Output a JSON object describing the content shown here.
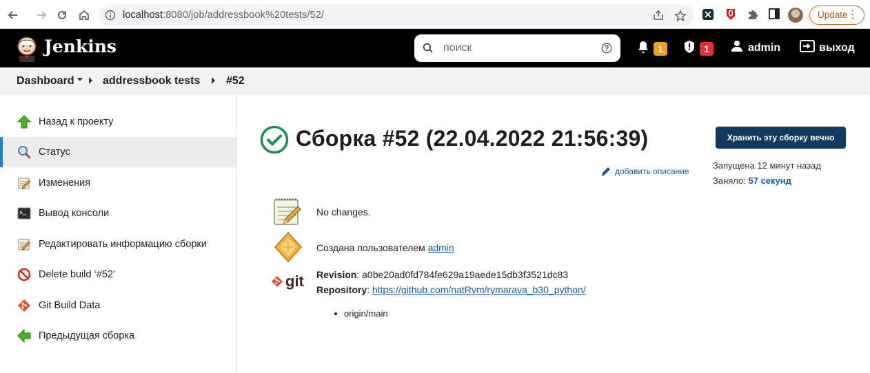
{
  "browser": {
    "url_host": "localhost",
    "url_path": ":8080/job/addressbook%20tests/52/",
    "update_label": "Update"
  },
  "header": {
    "brand": "Jenkins",
    "search_placeholder": "поиск",
    "notifications_count": "1",
    "security_count": "1",
    "user": "admin",
    "logout": "выход"
  },
  "breadcrumbs": {
    "dashboard": "Dashboard",
    "job": "addressbook tests",
    "build": "#52"
  },
  "sidebar": {
    "items": [
      {
        "label": "Назад к проекту",
        "icon": "up-arrow-icon"
      },
      {
        "label": "Статус",
        "icon": "magnifier-icon"
      },
      {
        "label": "Изменения",
        "icon": "notepad-icon"
      },
      {
        "label": "Вывод консоли",
        "icon": "terminal-icon"
      },
      {
        "label": "Редактировать информацию сборки",
        "icon": "notepad-icon"
      },
      {
        "label": "Delete build ‘#52’",
        "icon": "no-entry-icon"
      },
      {
        "label": "Git Build Data",
        "icon": "git-icon"
      },
      {
        "label": "Предыдущая сборка",
        "icon": "left-arrow-icon"
      }
    ]
  },
  "main": {
    "title": "Сборка #52 (22.04.2022 21:56:39)",
    "keep_button": "Хранить эту сборку вечно",
    "add_description": "добавить описание",
    "started_label": "Запущена 12 минут назад",
    "duration_prefix": "Заняло:",
    "duration_value": "57 секунд",
    "changes_text": "No changes.",
    "created_by_prefix": "Создана пользователем",
    "created_by_user": "admin",
    "git_label": "git",
    "revision_label": "Revision",
    "revision_value": "a0be20ad0fd784fe629a19aede15db3f3521dc83",
    "repository_label": "Repository",
    "repository_value": "https://github.com/natRym/rymarava_b30_python/",
    "branch": "origin/main"
  },
  "colors": {
    "header_bg": "#000000",
    "keep_button_bg": "#0e3a5f",
    "success_green": "#1f8a4c",
    "link_blue": "#1a5a9a",
    "badge_orange": "#f0a020",
    "badge_red": "#e0303a"
  }
}
